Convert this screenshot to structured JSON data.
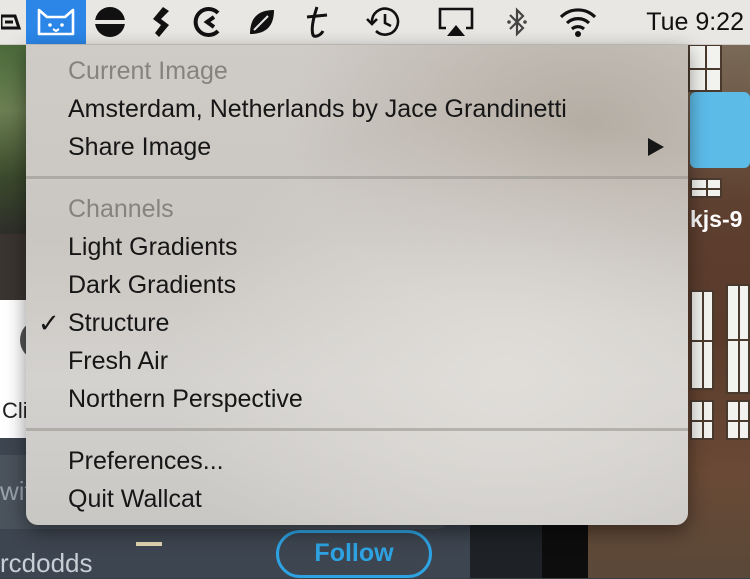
{
  "background": {
    "left_card_text": "Cli",
    "compose_text": "wit",
    "username": "rcdodds",
    "follow_label": "Follow",
    "right_label": "kjs-9"
  },
  "menubar": {
    "icons": [
      "trapezoid-icon",
      "wallcat-icon",
      "ball-icon",
      "dollar-icon",
      "cc-icon",
      "leaf-icon",
      "t-icon",
      "time-machine-icon",
      "airplay-icon",
      "bluetooth-icon",
      "wifi-icon"
    ],
    "clock": "Tue 9:22",
    "active_color": "#2b86e8"
  },
  "menu": {
    "current_image_header": "Current Image",
    "current_image_title": "Amsterdam, Netherlands by Jace Grandinetti",
    "share_image": "Share Image",
    "channels_header": "Channels",
    "channels": [
      {
        "label": "Light Gradients",
        "checked": false
      },
      {
        "label": "Dark Gradients",
        "checked": false
      },
      {
        "label": "Structure",
        "checked": true
      },
      {
        "label": "Fresh Air",
        "checked": false
      },
      {
        "label": "Northern Perspective",
        "checked": false
      }
    ],
    "checkmark": "✓",
    "preferences": "Preferences...",
    "quit": "Quit Wallcat"
  }
}
